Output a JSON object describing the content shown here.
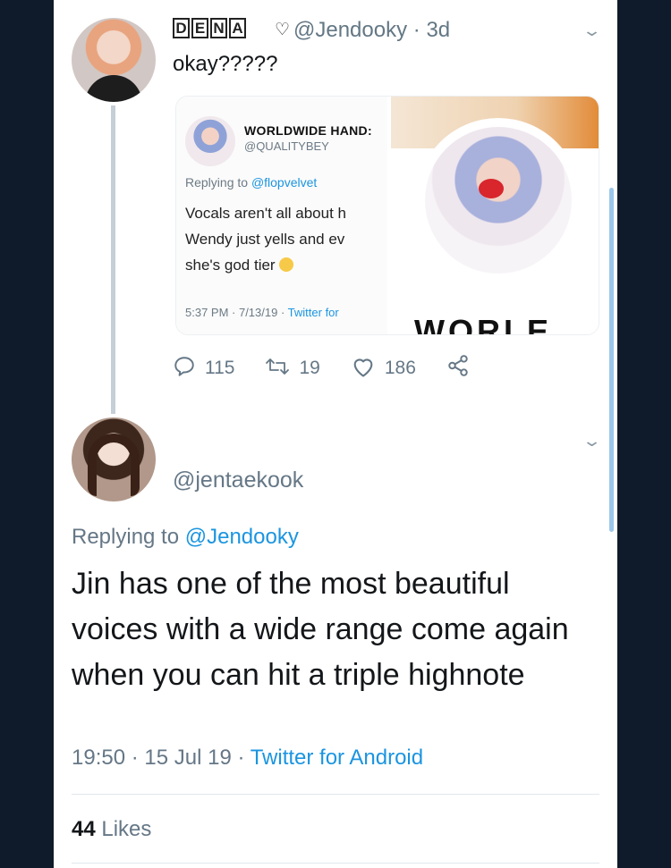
{
  "tweet1": {
    "display_name_letters": [
      "D",
      "E",
      "N",
      "A"
    ],
    "name_symbol": "♡",
    "handle": "@Jendooky",
    "time_ago": "· 3d",
    "text": "okay?????",
    "quote": {
      "name": "WORLDWIDE HAND:",
      "handle": "@QUALITYBEY",
      "replying_prefix": "Replying to ",
      "replying_handle": "@flopvelvet",
      "body_lines": [
        "Vocals aren't all about h",
        "Wendy just yells and ev",
        "she's god tier"
      ],
      "time": "5:37 PM · 7/13/19 · ",
      "source": "Twitter for",
      "banner_text": "WORLE"
    },
    "actions": {
      "replies": "115",
      "retweets": "19",
      "likes": "186"
    }
  },
  "tweet2": {
    "handle": "@jentaekook",
    "replying_prefix": "Replying to ",
    "replying_handle": "@Jendooky",
    "text": "Jin has one of the most beautiful voices with a wide range come again when you can hit a triple highnote",
    "time": "19:50 · 15 Jul 19 · ",
    "source": "Twitter for Android",
    "likes_count": "44",
    "likes_label": "Likes"
  },
  "icons": {
    "reply": "reply-icon",
    "retweet": "retweet-icon",
    "like": "heart-icon",
    "share": "share-icon",
    "chevron": "chevron-down-icon"
  },
  "colors": {
    "link": "#1b95e0",
    "muted": "#657786",
    "frame": "#0f1b2a"
  }
}
